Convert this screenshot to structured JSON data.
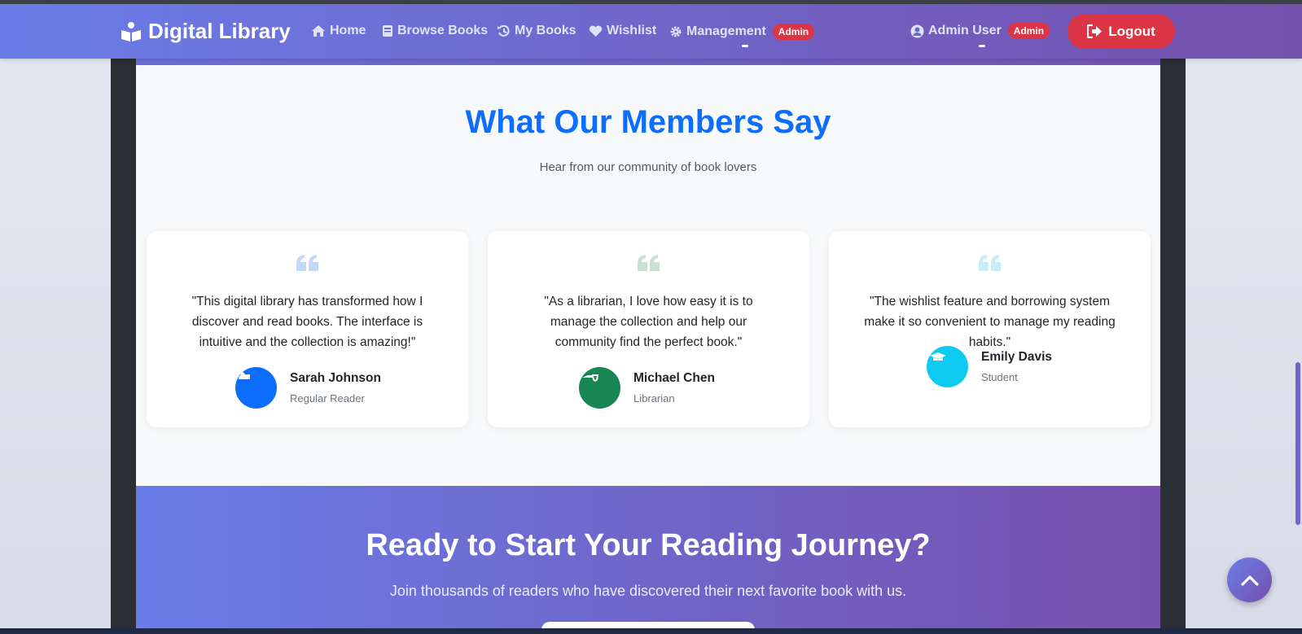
{
  "navbar": {
    "brand": "Digital Library",
    "items": [
      {
        "label": "Home",
        "icon": "home-icon"
      },
      {
        "label": "Browse Books",
        "icon": "book-icon"
      },
      {
        "label": "My Books",
        "icon": "history-icon"
      },
      {
        "label": "Wishlist",
        "icon": "heart-icon"
      },
      {
        "label": "Management",
        "icon": "gear-icon",
        "badge": "Admin"
      }
    ],
    "user": {
      "label": "Admin User",
      "badge": "Admin"
    },
    "logout_label": "Logout",
    "colors": {
      "accent": "#6f66c9",
      "danger": "#dc3545"
    }
  },
  "testimonials": {
    "title": "What Our Members Say",
    "subtitle": "Hear from our community of book lovers",
    "cards": [
      {
        "quote": "\"This digital library has transformed how I discover and read books. The interface is intuitive and the collection is amazing!\"",
        "name": "Sarah Johnson",
        "role": "Regular Reader",
        "avatar_color": "#0d6efd",
        "quote_color": "#c4d8fa"
      },
      {
        "quote": "\"As a librarian, I love how easy it is to manage the collection and help our community find the perfect book.\"",
        "name": "Michael Chen",
        "role": "Librarian",
        "avatar_color": "#198754",
        "quote_color": "#c9e0d4"
      },
      {
        "quote": "\"The wishlist feature and borrowing system make it so convenient to manage my reading habits.\"",
        "name": "Emily Davis",
        "role": "Student",
        "avatar_color": "#0dcaf0",
        "quote_color": "#c6eef8"
      }
    ]
  },
  "cta": {
    "title": "Ready to Start Your Reading Journey?",
    "subtitle": "Join thousands of readers who have discovered their next favorite book with us."
  }
}
